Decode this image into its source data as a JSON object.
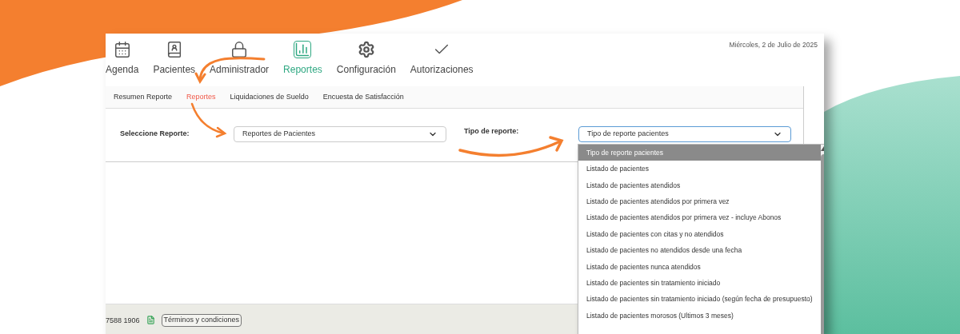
{
  "nav": [
    {
      "label": "Agenda",
      "selected": false
    },
    {
      "label": "Pacientes",
      "selected": false
    },
    {
      "label": "Administrador",
      "selected": false
    },
    {
      "label": "Reportes",
      "selected": true
    },
    {
      "label": "Configuración",
      "selected": false
    },
    {
      "label": "Autorizaciones",
      "selected": false
    }
  ],
  "date": "Miércoles, 2 de Julio de 2025",
  "subtabs": [
    {
      "label": "Resumen Reporte",
      "selected": false
    },
    {
      "label": "Reportes",
      "selected": true
    },
    {
      "label": "Liquidaciones de Sueldo",
      "selected": false
    },
    {
      "label": "Encuesta de Satisfacción",
      "selected": false
    }
  ],
  "form": {
    "report_label": "Seleccione Reporte:",
    "report_value": "Reportes de Pacientes",
    "type_label": "Tipo de reporte:",
    "type_value": "Tipo de reporte pacientes"
  },
  "dropdown": {
    "expanded": true,
    "options": [
      {
        "label": "Tipo de reporte pacientes",
        "selected": true
      },
      {
        "label": "Listado de pacientes",
        "selected": false
      },
      {
        "label": "Listado de pacientes atendidos",
        "selected": false
      },
      {
        "label": "Listado de pacientes atendidos por primera vez",
        "selected": false
      },
      {
        "label": "Listado de pacientes atendidos por primera vez - incluye Abonos",
        "selected": false
      },
      {
        "label": "Listado de pacientes con citas y no atendidos",
        "selected": false
      },
      {
        "label": "Listado de pacientes no atendidos desde una fecha",
        "selected": false
      },
      {
        "label": "Listado de pacientes nunca atendidos",
        "selected": false
      },
      {
        "label": "Listado de pacientes sin tratamiento iniciado",
        "selected": false
      },
      {
        "label": "Listado de pacientes sin tratamiento iniciado (según fecha de presupuesto)",
        "selected": false
      },
      {
        "label": "Listado de pacientes morosos (Ultimos 3 meses)",
        "selected": false
      }
    ]
  },
  "footer": {
    "phone": "7588 1906",
    "terms_button": "Términos y condiciones"
  }
}
